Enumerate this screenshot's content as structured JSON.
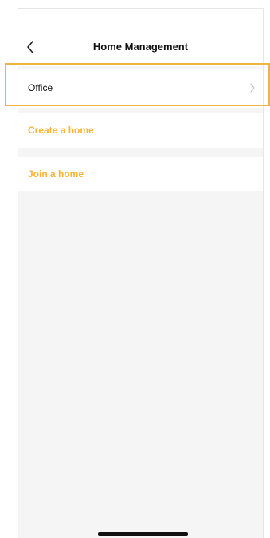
{
  "header": {
    "title": "Home Management",
    "back_icon": "chevron-left-icon"
  },
  "homes": [
    {
      "label": "Office",
      "icon": "chevron-right-icon"
    }
  ],
  "actions": {
    "create_label": "Create a home",
    "join_label": "Join a home"
  },
  "colors": {
    "accent": "#f8b536",
    "highlight": "#f0b440",
    "background": "#f5f5f5"
  }
}
